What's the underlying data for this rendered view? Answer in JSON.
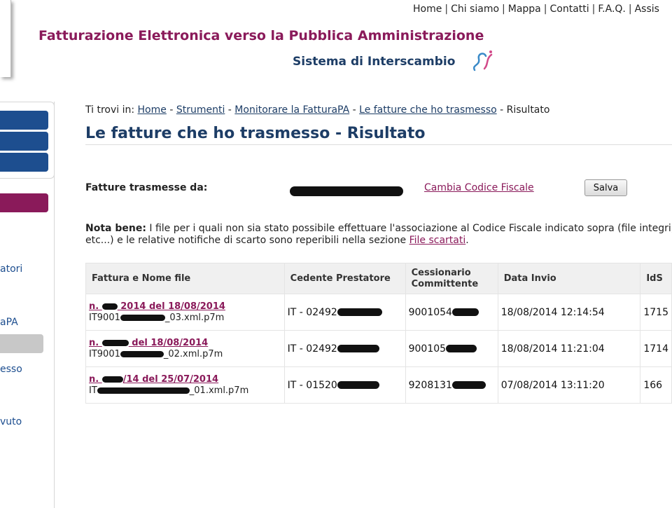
{
  "top_nav": [
    "Home",
    "Chi siamo",
    "Mappa",
    "Contatti",
    "F.A.Q.",
    "Assis"
  ],
  "header": {
    "title": "Fatturazione Elettronica verso la Pubblica Amministrazione",
    "subtitle": "Sistema di Interscambio"
  },
  "sidebar": {
    "texts": [
      "atori",
      "aPA",
      "esso",
      "vuto"
    ]
  },
  "breadcrumb": {
    "prefix": "Ti trovi in:",
    "items": [
      "Home",
      "Strumenti",
      "Monitorare la FatturaPA",
      "Le fatture che ho trasmesso"
    ],
    "current": "Risultato"
  },
  "page_title": "Le fatture che ho trasmesso - Risultato",
  "sender": {
    "label": "Fatture trasmesse da:",
    "change_link": "Cambia Codice Fiscale",
    "save_button": "Salva"
  },
  "note": {
    "bold": "Nota bene:",
    "text": " I file per i quali non sia stato possibile effettuare l'associazione al Codice Fiscale indicato sopra (file integri, etc...) e le relative notifiche di scarto sono reperibili nella sezione ",
    "link": "File scartati",
    "end": "."
  },
  "table": {
    "headers": [
      "Fattura e Nome file",
      "Cedente Prestatore",
      "Cessionario Committente",
      "Data Invio",
      "IdS"
    ],
    "rows": [
      {
        "inv_a": "n. ",
        "inv_b": " 2014 del 18/08/2014",
        "file_a": "IT9001",
        "file_b": "_03.xml.p7m",
        "cedente": "IT - 02492",
        "cessionario": "9001054",
        "data": "18/08/2014 12:14:54",
        "ids": "1715"
      },
      {
        "inv_a": "n. ",
        "inv_b": " del 18/08/2014",
        "file_a": "IT9001",
        "file_b": "_02.xml.p7m",
        "cedente": "IT - 02492",
        "cessionario": "900105",
        "data": "18/08/2014 11:21:04",
        "ids": "1714"
      },
      {
        "inv_a": "n. ",
        "inv_b": "/14 del 25/07/2014",
        "file_a": "IT",
        "file_b": "_01.xml.p7m",
        "cedente": "IT - 01520",
        "cessionario": "9208131",
        "data": "07/08/2014 13:11:20",
        "ids": "166"
      }
    ]
  },
  "colors": {
    "brand_magenta": "#8a1a5a",
    "brand_navy": "#1d3d66",
    "button_blue": "#1d4e8f"
  }
}
